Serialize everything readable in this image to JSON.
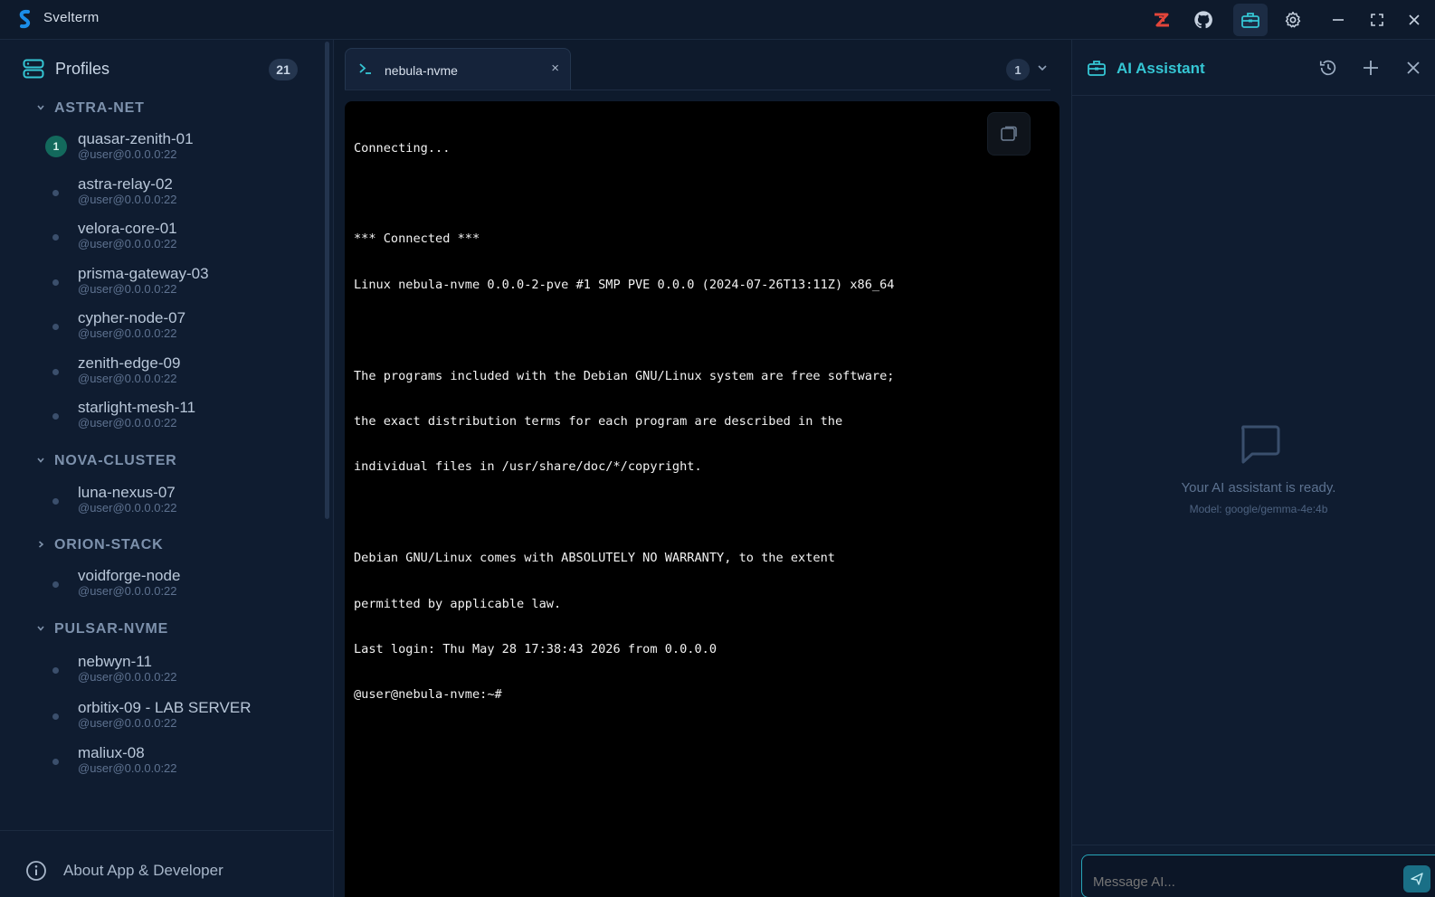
{
  "app": {
    "title": "Svelterm"
  },
  "sidebar": {
    "profiles_label": "Profiles",
    "profiles_count": "21",
    "groups": [
      {
        "name": "ASTRA-NET",
        "expanded": true,
        "hosts": [
          {
            "name": "quasar-zenith-01",
            "addr": "@user@0.0.0.0:22",
            "badge": "1"
          },
          {
            "name": "astra-relay-02",
            "addr": "@user@0.0.0.0:22"
          },
          {
            "name": "velora-core-01",
            "addr": "@user@0.0.0.0:22"
          },
          {
            "name": "prisma-gateway-03",
            "addr": "@user@0.0.0.0:22"
          },
          {
            "name": "cypher-node-07",
            "addr": "@user@0.0.0.0:22"
          },
          {
            "name": "zenith-edge-09",
            "addr": "@user@0.0.0.0:22"
          },
          {
            "name": "starlight-mesh-11",
            "addr": "@user@0.0.0.0:22"
          }
        ]
      },
      {
        "name": "NOVA-CLUSTER",
        "expanded": true,
        "hosts": [
          {
            "name": "luna-nexus-07",
            "addr": "@user@0.0.0.0:22"
          }
        ]
      },
      {
        "name": "ORION-STACK",
        "expanded": false,
        "hosts": [
          {
            "name": "voidforge-node",
            "addr": "@user@0.0.0.0:22"
          }
        ]
      },
      {
        "name": "PULSAR-NVME",
        "expanded": true,
        "hosts": [
          {
            "name": "nebwyn-11",
            "addr": "@user@0.0.0.0:22"
          },
          {
            "name": "orbitix-09 - LAB SERVER",
            "addr": "@user@0.0.0.0:22"
          },
          {
            "name": "maliux-08",
            "addr": "@user@0.0.0.0:22"
          }
        ]
      }
    ],
    "about_label": "About App & Developer"
  },
  "tabs": {
    "active": {
      "label": "nebula-nvme",
      "close": "×"
    },
    "count": "1"
  },
  "terminal": {
    "lines": [
      "Connecting...",
      "",
      "*** Connected ***",
      "Linux nebula-nvme 0.0.0-2-pve #1 SMP PVE 0.0.0 (2024-07-26T13:11Z) x86_64",
      "",
      "The programs included with the Debian GNU/Linux system are free software;",
      "the exact distribution terms for each program are described in the",
      "individual files in /usr/share/doc/*/copyright.",
      "",
      "Debian GNU/Linux comes with ABSOLUTELY NO WARRANTY, to the extent",
      "permitted by applicable law.",
      "Last login: Thu May 28 17:38:43 2026 from 0.0.0.0",
      "@user@nebula-nvme:~#"
    ]
  },
  "ai": {
    "title": "AI Assistant",
    "ready_text": "Your AI assistant is ready.",
    "model_text": "Model: google/gemma-4e:4b",
    "input_placeholder": "Message AI..."
  },
  "colors": {
    "accent": "#35c6d4",
    "badge_active": "#13695c",
    "background": "#0f1b2d",
    "terminal_bg": "#000000"
  },
  "icons": {
    "titlebar": [
      "brand-red-icon",
      "github-icon",
      "toolbox-icon",
      "gear-icon",
      "minimize-icon",
      "maximize-icon",
      "close-icon"
    ]
  }
}
